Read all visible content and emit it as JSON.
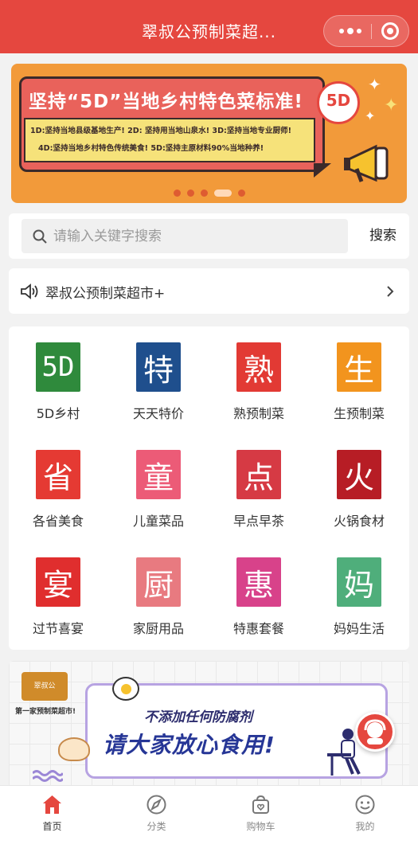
{
  "header": {
    "title": "翠叔公预制菜超...",
    "more_icon": "more-dots-icon",
    "close_icon": "target-icon",
    "color": "#e5473f"
  },
  "banner": {
    "headline": "坚持“5D”当地乡村特色菜标准!",
    "notes": [
      "1D:坚持当地县级基地生产! 2D: 坚持用当地山泉水! 3D:坚持当地专业厨师!",
      "4D:坚持当地乡村特色传统美食! 5D:坚持主原材料90%当地种养!"
    ],
    "badge": "5D",
    "slide_count": 5,
    "active_slide": 4
  },
  "search": {
    "placeholder": "请输入关键字搜索",
    "button_label": "搜索"
  },
  "notice": {
    "text": "翠叔公预制菜超市+"
  },
  "categories": [
    {
      "glyph": "5D",
      "label": "5D乡村"
    },
    {
      "glyph": "特",
      "label": "天天特价"
    },
    {
      "glyph": "熟",
      "label": "熟预制菜"
    },
    {
      "glyph": "生",
      "label": "生预制菜"
    },
    {
      "glyph": "省",
      "label": "各省美食"
    },
    {
      "glyph": "童",
      "label": "儿童菜品"
    },
    {
      "glyph": "点",
      "label": "早点早茶"
    },
    {
      "glyph": "火",
      "label": "火锅食材"
    },
    {
      "glyph": "宴",
      "label": "过节喜宴"
    },
    {
      "glyph": "厨",
      "label": "家厨用品"
    },
    {
      "glyph": "惠",
      "label": "特惠套餐"
    },
    {
      "glyph": "妈",
      "label": "妈妈生活"
    }
  ],
  "promo": {
    "logo_text": "翠叔公",
    "tagline": "第一家预制菜超市!",
    "line1": "不添加任何防腐剂",
    "line2": "请大家放心食用!"
  },
  "tabbar": {
    "tabs": [
      {
        "label": "首页",
        "icon": "home-icon",
        "active": true
      },
      {
        "label": "分类",
        "icon": "category-icon",
        "active": false
      },
      {
        "label": "购物车",
        "icon": "cart-icon",
        "active": false
      },
      {
        "label": "我的",
        "icon": "profile-icon",
        "active": false
      }
    ],
    "active_color": "#e5473f"
  }
}
